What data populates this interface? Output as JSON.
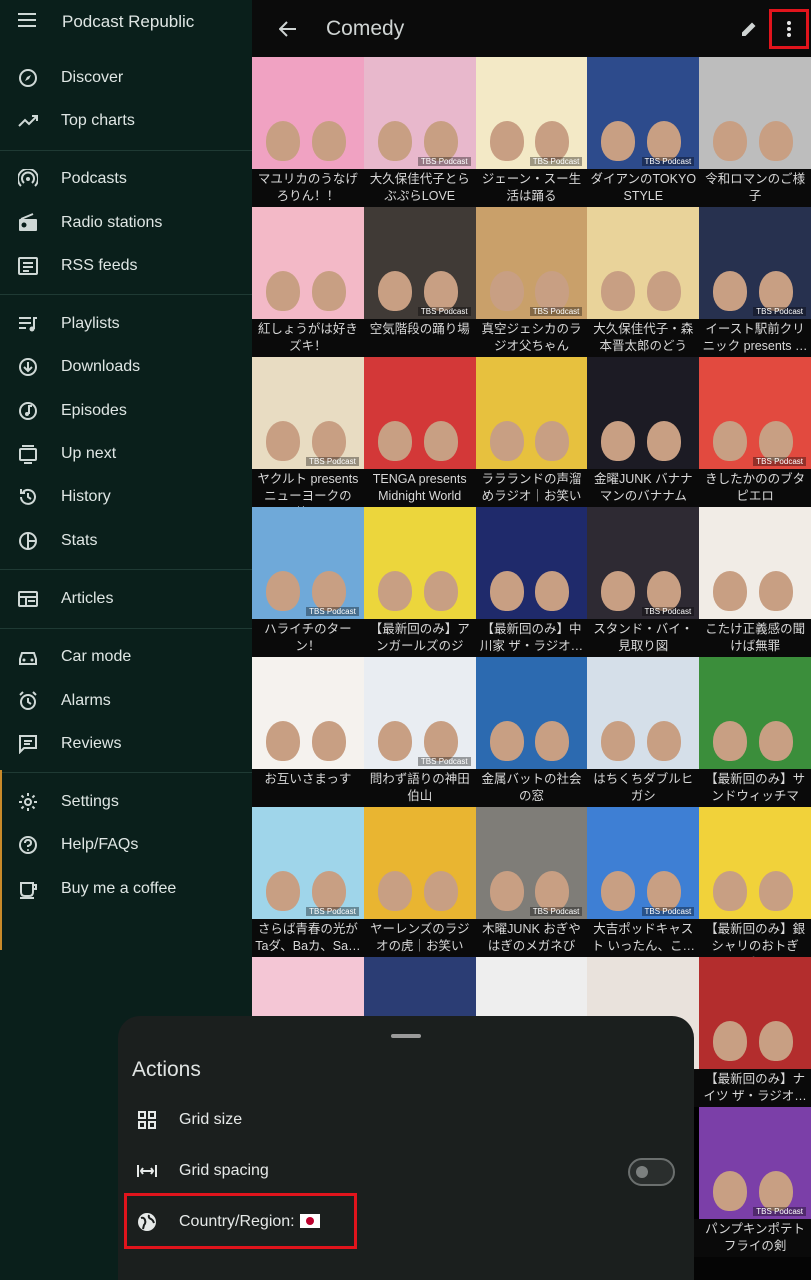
{
  "app": {
    "title": "Podcast Republic"
  },
  "drawer": {
    "groups": [
      [
        {
          "label": "Discover",
          "icon": "compass-icon"
        },
        {
          "label": "Top charts",
          "icon": "trending-icon"
        }
      ],
      [
        {
          "label": "Podcasts",
          "icon": "podcast-icon"
        },
        {
          "label": "Radio stations",
          "icon": "radio-icon"
        },
        {
          "label": "RSS feeds",
          "icon": "rss-feed-icon"
        }
      ],
      [
        {
          "label": "Playlists",
          "icon": "playlist-icon"
        },
        {
          "label": "Downloads",
          "icon": "download-icon"
        },
        {
          "label": "Episodes",
          "icon": "music-note-icon"
        },
        {
          "label": "Up next",
          "icon": "queue-icon"
        },
        {
          "label": "History",
          "icon": "history-icon"
        },
        {
          "label": "Stats",
          "icon": "pie-chart-icon"
        }
      ],
      [
        {
          "label": "Articles",
          "icon": "article-icon"
        }
      ],
      [
        {
          "label": "Car mode",
          "icon": "car-icon"
        },
        {
          "label": "Alarms",
          "icon": "alarm-icon"
        },
        {
          "label": "Reviews",
          "icon": "review-icon"
        }
      ],
      [
        {
          "label": "Settings",
          "icon": "gear-icon"
        },
        {
          "label": "Help/FAQs",
          "icon": "help-icon"
        },
        {
          "label": "Buy me a coffee",
          "icon": "coffee-icon"
        }
      ]
    ]
  },
  "toolbar": {
    "title": "Comedy"
  },
  "grid": {
    "items": [
      {
        "title": "マユリカのうなげろりん！！",
        "color": "#f0a2c2",
        "badge": ""
      },
      {
        "title": "大久保佳代子とらぶぷらLOVE",
        "color": "#e8b8cc",
        "badge": "TBS Podcast"
      },
      {
        "title": "ジェーン・スー生活は踊る",
        "color": "#f3e9c6",
        "badge": "TBS Podcast"
      },
      {
        "title": "ダイアンのTOKYO STYLE",
        "color": "#2d4b8c",
        "badge": "TBS Podcast"
      },
      {
        "title": "令和ロマンのご様子",
        "color": "#bdbdbd",
        "badge": ""
      },
      {
        "title": "紅しょうがは好きズキ！",
        "color": "#f3b9c7",
        "badge": ""
      },
      {
        "title": "空気階段の踊り場",
        "color": "#403a36",
        "badge": "TBS Podcast"
      },
      {
        "title": "真空ジェシカのラジオ父ちゃん",
        "color": "#c9a06a",
        "badge": "TBS Podcast"
      },
      {
        "title": "大久保佳代子・森本晋太郎のどうぞ…",
        "color": "#e9d39a",
        "badge": ""
      },
      {
        "title": "イースト駅前クリニック presents …",
        "color": "#27314f",
        "badge": "TBS Podcast"
      },
      {
        "title": "ヤクルト presents ニューヨークの放…",
        "color": "#e8dcc2",
        "badge": "TBS Podcast"
      },
      {
        "title": "TENGA presents Midnight World C…",
        "color": "#d33838",
        "badge": ""
      },
      {
        "title": "ララランドの声溜めラジオ｜お笑いラ…",
        "color": "#e7c13e",
        "badge": ""
      },
      {
        "title": "金曜JUNK バナナマンのバナナムー…",
        "color": "#1c1b24",
        "badge": ""
      },
      {
        "title": "きしたかののブタピエロ",
        "color": "#e24a3f",
        "badge": "TBS Podcast"
      },
      {
        "title": "ハライチのターン！",
        "color": "#6fa9d9",
        "badge": "TBS Podcast"
      },
      {
        "title": "【最新回のみ】アンガールズのジャ…",
        "color": "#ecd63c",
        "badge": ""
      },
      {
        "title": "【最新回のみ】中川家 ザ・ラジオ…",
        "color": "#1f2a6b",
        "badge": ""
      },
      {
        "title": "スタンド・バイ・見取り図",
        "color": "#2e2a33",
        "badge": "TBS Podcast"
      },
      {
        "title": "こたけ正義感の聞けば無罪",
        "color": "#f1ece6",
        "badge": ""
      },
      {
        "title": "お互いさまっす",
        "color": "#f5f2ee",
        "badge": ""
      },
      {
        "title": "問わず語りの神田伯山",
        "color": "#e9edf2",
        "badge": "TBS Podcast"
      },
      {
        "title": "金属バットの社会の窓",
        "color": "#2c6ab0",
        "badge": ""
      },
      {
        "title": "はちくちダブルヒガシ",
        "color": "#d5dfe9",
        "badge": ""
      },
      {
        "title": "【最新回のみ】サンドウィッチマン…",
        "color": "#3b8e3b",
        "badge": ""
      },
      {
        "title": "さらば青春の光がTaダ、Baカ、Sa…",
        "color": "#9fd5ea",
        "badge": "TBS Podcast"
      },
      {
        "title": "ヤーレンズのラジオの虎｜お笑いラ…",
        "color": "#e9b531",
        "badge": ""
      },
      {
        "title": "木曜JUNK おぎやはぎのメガネびい…",
        "color": "#7f7d78",
        "badge": "TBS Podcast"
      },
      {
        "title": "大吉ポッドキャスト いったん、こ…",
        "color": "#3e7fd4",
        "badge": "TBS Podcast"
      },
      {
        "title": "【最新回のみ】銀シャリのおトぎば…",
        "color": "#f1d23a",
        "badge": ""
      },
      {
        "title": "",
        "color": "#f4c6d5",
        "badge": ""
      },
      {
        "title": "",
        "color": "#2b3d74",
        "badge": ""
      },
      {
        "title": "",
        "color": "#eeeeee",
        "badge": ""
      },
      {
        "title": "",
        "color": "#e9e2dc",
        "badge": ""
      },
      {
        "title": "【最新回のみ】ナイツ ザ・ラジオ…",
        "color": "#b32d2d",
        "badge": ""
      },
      {
        "title": "",
        "color": "#000000",
        "badge": ""
      },
      {
        "title": "",
        "color": "#000000",
        "badge": ""
      },
      {
        "title": "",
        "color": "#000000",
        "badge": ""
      },
      {
        "title": "",
        "color": "#000000",
        "badge": ""
      },
      {
        "title": "パンプキンポテトフライの剣",
        "color": "#7b3fa8",
        "badge": "TBS Podcast"
      }
    ]
  },
  "sheet": {
    "title": "Actions",
    "items": [
      {
        "label": "Grid size",
        "icon": "grid-icon"
      },
      {
        "label": "Grid spacing",
        "icon": "spacing-icon",
        "toggle": "off"
      },
      {
        "label": "Country/Region:",
        "icon": "globe-icon",
        "flag": "japan-flag-icon"
      }
    ]
  }
}
